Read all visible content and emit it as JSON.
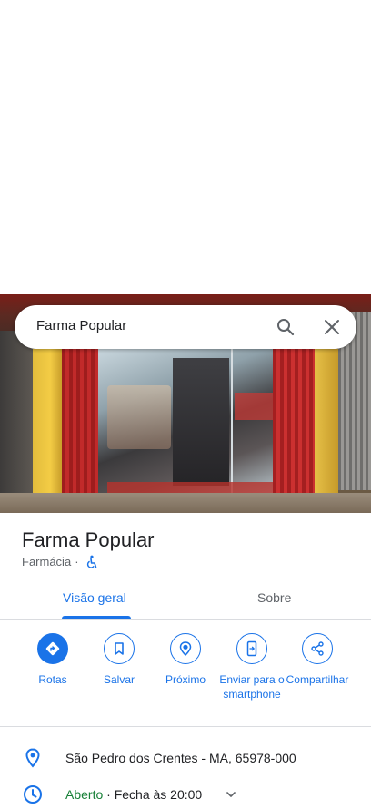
{
  "search": {
    "query": "Farma Popular"
  },
  "place": {
    "name": "Farma Popular",
    "category": "Farmácia",
    "separator": "·"
  },
  "tabs": [
    {
      "label": "Visão geral",
      "active": true
    },
    {
      "label": "Sobre",
      "active": false
    }
  ],
  "actions": [
    {
      "label": "Rotas",
      "icon": "directions-icon"
    },
    {
      "label": "Salvar",
      "icon": "bookmark-icon"
    },
    {
      "label": "Próximo",
      "icon": "nearby-icon"
    },
    {
      "label": "Enviar para o smartphone",
      "icon": "send-to-phone-icon"
    },
    {
      "label": "Compartilhar",
      "icon": "share-icon"
    }
  ],
  "info": {
    "address": "São Pedro dos Crentes - MA, 65978-000",
    "hours_status": "Aberto",
    "hours_sep": "·",
    "hours_detail": "Fecha às 20:00"
  },
  "colors": {
    "accent": "#1a73e8",
    "open": "#188038",
    "text": "#202124",
    "secondary": "#5f6368"
  }
}
